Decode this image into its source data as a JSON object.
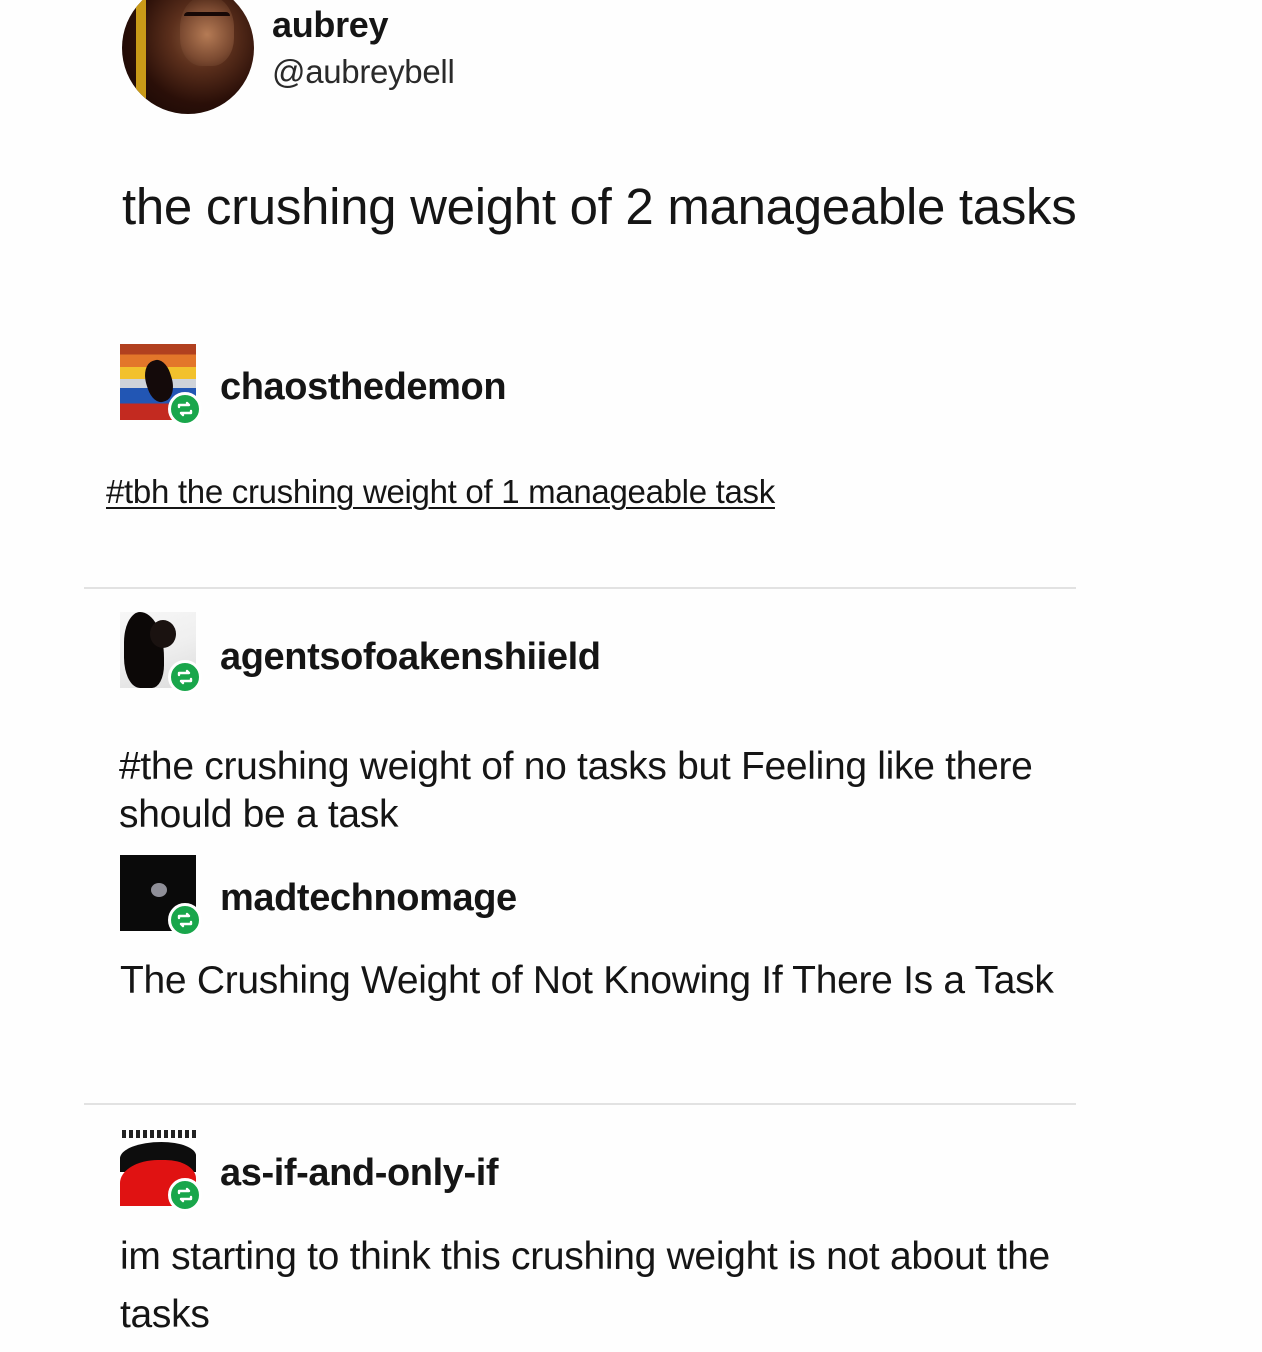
{
  "original_post": {
    "name": "aubrey",
    "handle": "@aubreybell",
    "text": "the crushing weight of 2 manageable tasks"
  },
  "reblogs": [
    {
      "username": "chaosthedemon",
      "tag": "#tbh the crushing weight of 1 manageable task"
    },
    {
      "username": "agentsofoakenshiield",
      "text": "#the crushing weight of no tasks but Feeling like there should be a task"
    },
    {
      "username": "madtechnomage",
      "text": "The Crushing Weight of Not Knowing If There Is a Task"
    },
    {
      "username": "as-if-and-only-if",
      "text": "im starting to think this crushing weight is not about the tasks"
    }
  ],
  "colors": {
    "reblog_badge": "#19a64b",
    "divider": "#e2e2e2",
    "text": "#151515"
  },
  "icons": {
    "reblog": "reblog-icon"
  }
}
